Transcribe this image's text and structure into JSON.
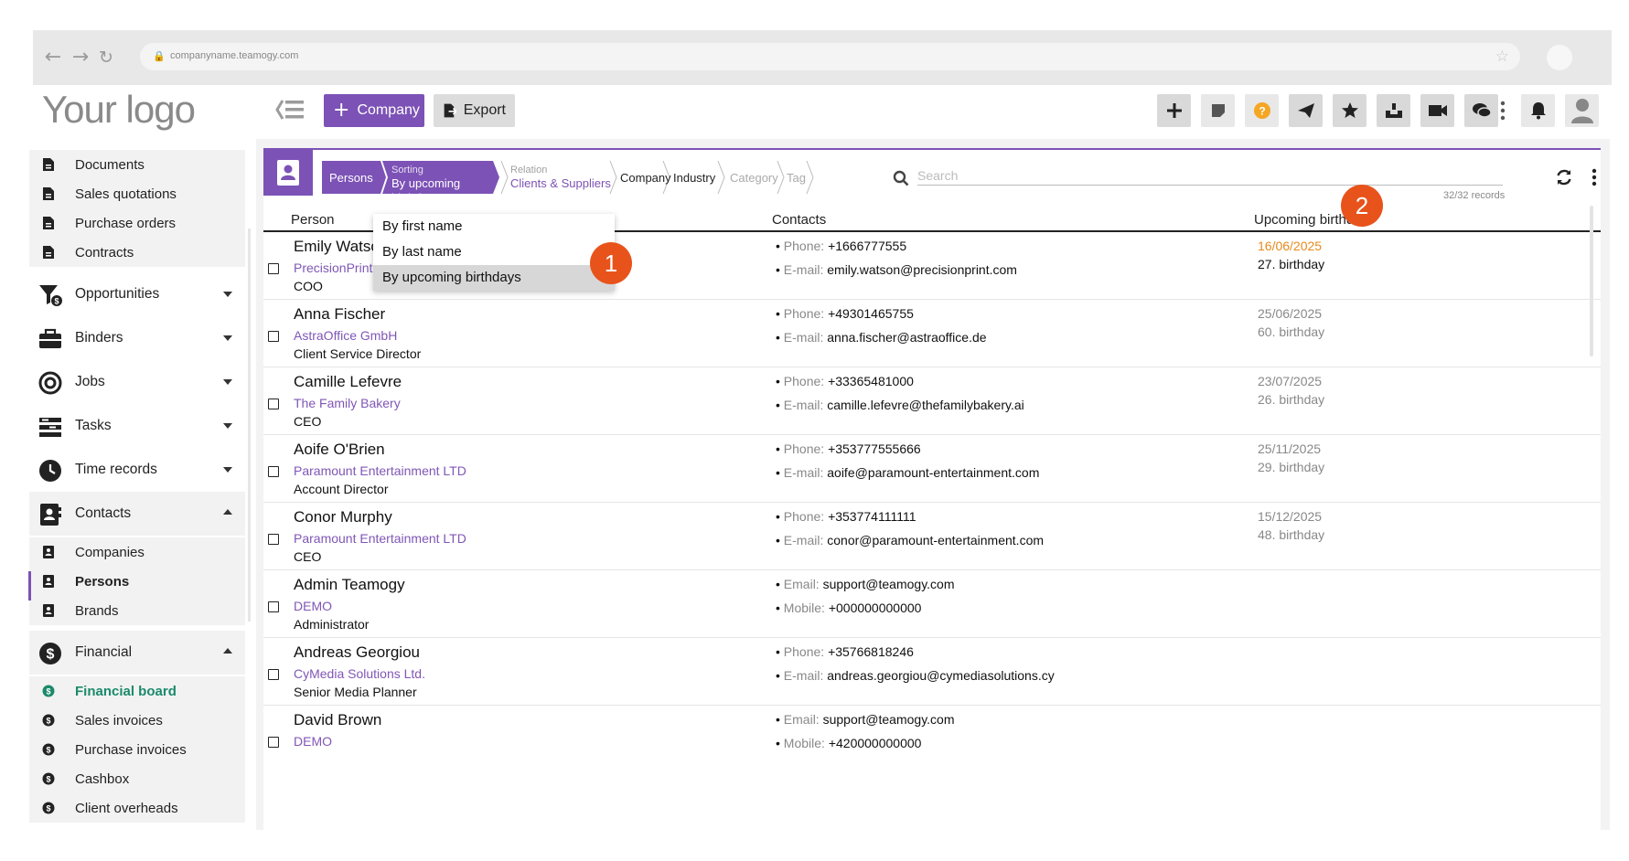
{
  "browser": {
    "url": "companyname.teamogy.com"
  },
  "logo": "Your logo",
  "toolbar": {
    "company_label": "Company",
    "export_label": "Export"
  },
  "sidebar": {
    "docs": [
      "Documents",
      "Sales quotations",
      "Purchase orders",
      "Contracts"
    ],
    "opportunities": "Opportunities",
    "binders": "Binders",
    "jobs": "Jobs",
    "tasks": "Tasks",
    "time_records": "Time records",
    "contacts": "Contacts",
    "contacts_items": [
      "Companies",
      "Persons",
      "Brands"
    ],
    "financial": "Financial",
    "financial_items": [
      "Financial board",
      "Sales invoices",
      "Purchase invoices",
      "Cashbox",
      "Client overheads"
    ]
  },
  "breadcrumb": {
    "persons": "Persons",
    "sorting_label": "Sorting",
    "sorting_value": "By upcoming birthdays",
    "relation_label": "Relation",
    "relation_value": "Clients & Suppliers",
    "company": "Company",
    "industry": "Industry",
    "category": "Category",
    "tag": "Tag"
  },
  "search": {
    "placeholder": "Search"
  },
  "records": "32/32 records",
  "table": {
    "col_person": "Person",
    "col_contacts": "Contacts",
    "col_birthday": "Upcoming birthday",
    "rows": [
      {
        "name": "Emily Watson",
        "company": "PrecisionPrint",
        "role": "COO",
        "l1_label": "Phone:",
        "l1_value": "+1666777555",
        "l2_label": "E-mail:",
        "l2_value": "emily.watson@precisionprint.com",
        "date": "16/06/2025",
        "age": "27. birthday"
      },
      {
        "name": "Anna Fischer",
        "company": "AstraOffice GmbH",
        "role": "Client Service Director",
        "l1_label": "Phone:",
        "l1_value": "+49301465755",
        "l2_label": "E-mail:",
        "l2_value": "anna.fischer@astraoffice.de",
        "date": "25/06/2025",
        "age": "60. birthday"
      },
      {
        "name": "Camille Lefevre",
        "company": "The Family Bakery",
        "role": "CEO",
        "l1_label": "Phone:",
        "l1_value": "+33365481000",
        "l2_label": "E-mail:",
        "l2_value": "camille.lefevre@thefamilybakery.ai",
        "date": "23/07/2025",
        "age": "26. birthday"
      },
      {
        "name": "Aoife O'Brien",
        "company": "Paramount Entertainment LTD",
        "role": "Account Director",
        "l1_label": "Phone:",
        "l1_value": "+353777555666",
        "l2_label": "E-mail:",
        "l2_value": "aoife@paramount-entertainment.com",
        "date": "25/11/2025",
        "age": "29. birthday"
      },
      {
        "name": "Conor Murphy",
        "company": "Paramount Entertainment LTD",
        "role": "CEO",
        "l1_label": "Phone:",
        "l1_value": "+353774111111",
        "l2_label": "E-mail:",
        "l2_value": "conor@paramount-entertainment.com",
        "date": "15/12/2025",
        "age": "48. birthday"
      },
      {
        "name": "Admin Teamogy",
        "company": "DEMO",
        "role": "Administrator",
        "l1_label": "Email:",
        "l1_value": "support@teamogy.com",
        "l2_label": "Mobile:",
        "l2_value": "+000000000000",
        "date": "",
        "age": ""
      },
      {
        "name": "Andreas Georgiou",
        "company": "CyMedia Solutions Ltd.",
        "role": "Senior Media Planner",
        "l1_label": "Phone:",
        "l1_value": "+35766818246",
        "l2_label": "E-mail:",
        "l2_value": "andreas.georgiou@cymediasolutions.cy",
        "date": "",
        "age": ""
      },
      {
        "name": "David Brown",
        "company": "DEMO",
        "role": "",
        "l1_label": "Email:",
        "l1_value": "support@teamogy.com",
        "l2_label": "Mobile:",
        "l2_value": "+420000000000",
        "date": "",
        "age": ""
      }
    ]
  },
  "dropdown": {
    "items": [
      "By first name",
      "By last name",
      "By upcoming birthdays"
    ]
  },
  "badges": {
    "one": "1",
    "two": "2"
  },
  "colors": {
    "accent": "#7c52b6",
    "highlight_date": "#e68a1c",
    "badge": "#e8531b",
    "financial_active": "#1b8a6b"
  }
}
